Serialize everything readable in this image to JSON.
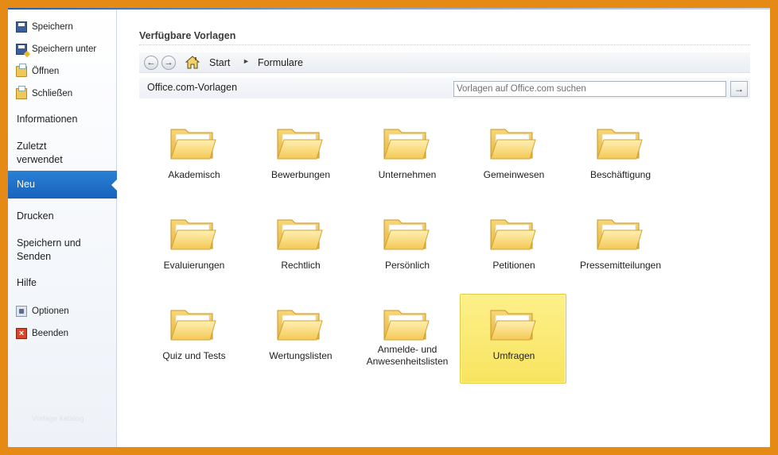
{
  "sidebar": {
    "save": "Speichern",
    "save_as": "Speichern unter",
    "open": "Öffnen",
    "close": "Schließen",
    "info": "Informationen",
    "recent": "Zuletzt verwendet",
    "new": "Neu",
    "print": "Drucken",
    "save_send": "Speichern und Senden",
    "help": "Hilfe",
    "options": "Optionen",
    "exit": "Beenden",
    "watermark": "Vorlage katalog"
  },
  "main": {
    "heading": "Verfügbare Vorlagen",
    "breadcrumb": [
      "Start",
      "Formulare"
    ],
    "section_label": "Office.com-Vorlagen",
    "search_placeholder": "Vorlagen auf Office.com suchen",
    "folders": [
      "Akademisch",
      "Bewerbungen",
      "Unternehmen",
      "Gemeinwesen",
      "Beschäftigung",
      "Evaluierungen",
      "Rechtlich",
      "Persönlich",
      "Petitionen",
      "Pressemitteilungen",
      "Quiz und Tests",
      "Wertungslisten",
      "Anmelde- und Anwesenheitslisten",
      "Umfragen"
    ],
    "selected_folder": "Umfragen"
  },
  "colors": {
    "frame": "#e58a14",
    "active_nav": "#1f6cc6",
    "selected_tile": "#fbe96f"
  }
}
